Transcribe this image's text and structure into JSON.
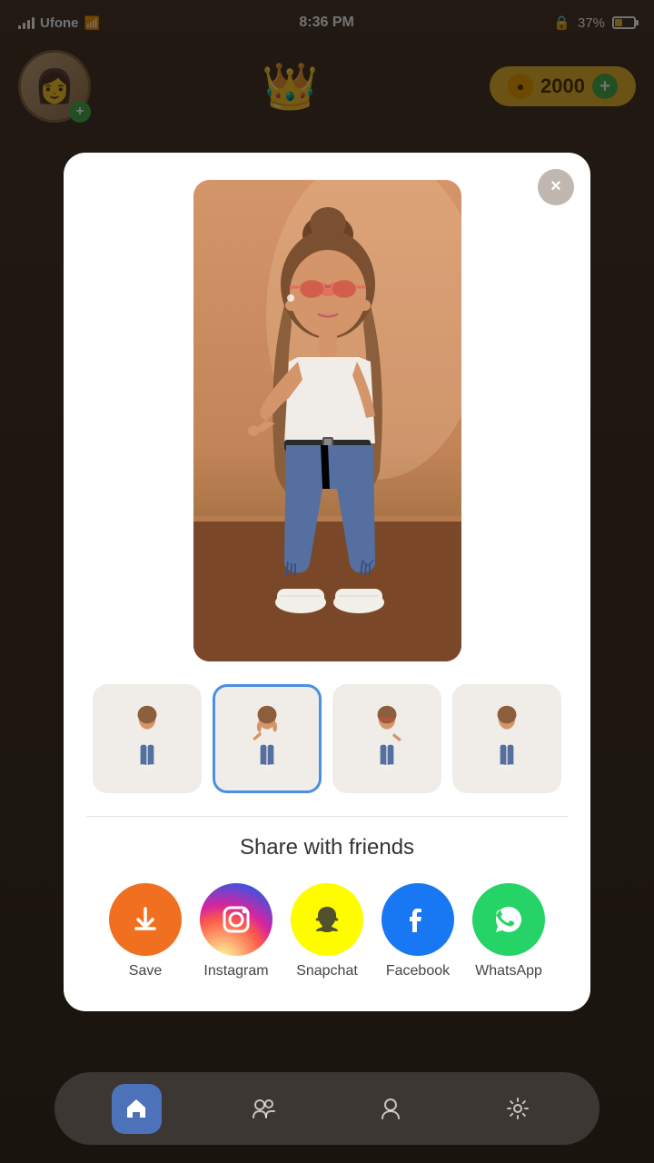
{
  "statusBar": {
    "carrier": "Ufone",
    "time": "8:36 PM",
    "battery": "37%"
  },
  "topBar": {
    "coins": "2000"
  },
  "modal": {
    "closeLabel": "×",
    "shareTitle": "Share with friends",
    "shareItems": [
      {
        "id": "save",
        "label": "Save",
        "color": "#f07020"
      },
      {
        "id": "instagram",
        "label": "Instagram",
        "color": "gradient"
      },
      {
        "id": "snapchat",
        "label": "Snapchat",
        "color": "#FFFC00"
      },
      {
        "id": "facebook",
        "label": "Facebook",
        "color": "#1877F2"
      },
      {
        "id": "whatsapp",
        "label": "WhatsApp",
        "color": "#25D366"
      }
    ]
  },
  "bottomNav": {
    "items": [
      "home",
      "friends",
      "avatar",
      "settings"
    ]
  }
}
